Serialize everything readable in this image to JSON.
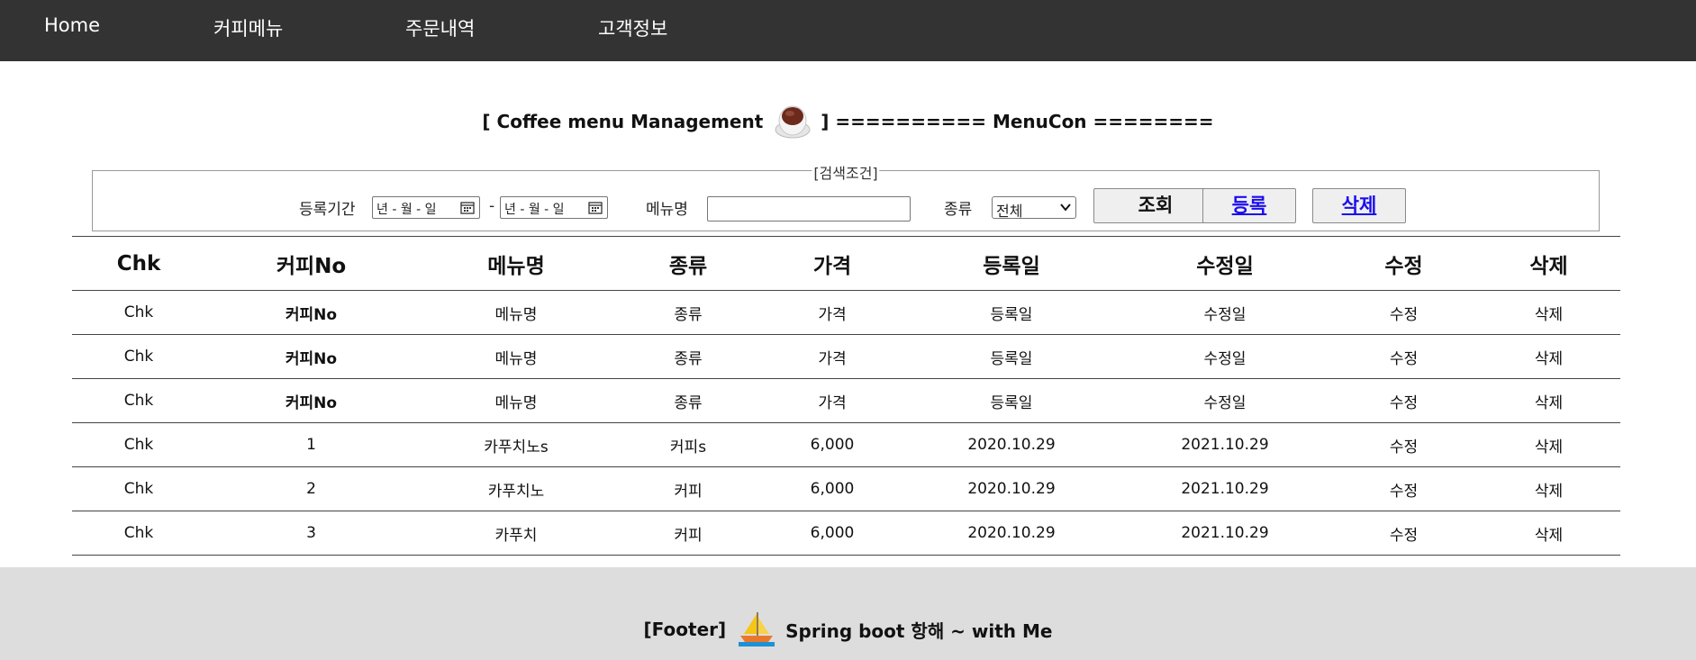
{
  "nav": {
    "items": [
      "Home",
      "커피메뉴",
      "주문내역",
      "고객정보"
    ]
  },
  "title": {
    "left": "[ Coffee menu Management",
    "icon": "coffee-cup-icon",
    "right": "] ========== MenuCon ========"
  },
  "search": {
    "legend": "[검색조건]",
    "period_label": "등록기간",
    "date_start_placeholder": "년 - 월 - 일",
    "date_sep": "-",
    "date_end_placeholder": "년 - 월 - 일",
    "menu_label": "메뉴명",
    "menu_value": "",
    "kind_label": "종류",
    "kind_selected": "전체",
    "btn_search": "조회",
    "btn_register": "등록",
    "btn_delete": "삭제"
  },
  "table": {
    "headers": [
      "Chk",
      "커피No",
      "메뉴명",
      "종류",
      "가격",
      "등록일",
      "수정일",
      "수정",
      "삭제"
    ],
    "rows": [
      [
        "Chk",
        "커피No",
        "메뉴명",
        "종류",
        "가격",
        "등록일",
        "수정일",
        "수정",
        "삭제"
      ],
      [
        "Chk",
        "커피No",
        "메뉴명",
        "종류",
        "가격",
        "등록일",
        "수정일",
        "수정",
        "삭제"
      ],
      [
        "Chk",
        "커피No",
        "메뉴명",
        "종류",
        "가격",
        "등록일",
        "수정일",
        "수정",
        "삭제"
      ],
      [
        "Chk",
        "1",
        "카푸치노s",
        "커피s",
        "6,000",
        "2020.10.29",
        "2021.10.29",
        "수정",
        "삭제"
      ],
      [
        "Chk",
        "2",
        "카푸치노",
        "커피",
        "6,000",
        "2020.10.29",
        "2021.10.29",
        "수정",
        "삭제"
      ],
      [
        "Chk",
        "3",
        "카푸치",
        "커피",
        "6,000",
        "2020.10.29",
        "2021.10.29",
        "수정",
        "삭제"
      ]
    ]
  },
  "footer": {
    "left": "[Footer]",
    "icon": "sailboat-icon",
    "right": "Spring boot 항해 ~ with Me"
  },
  "colors": {
    "nav_bg": "#333333",
    "footer_bg": "#dddddd",
    "link": "#1a0dee"
  }
}
